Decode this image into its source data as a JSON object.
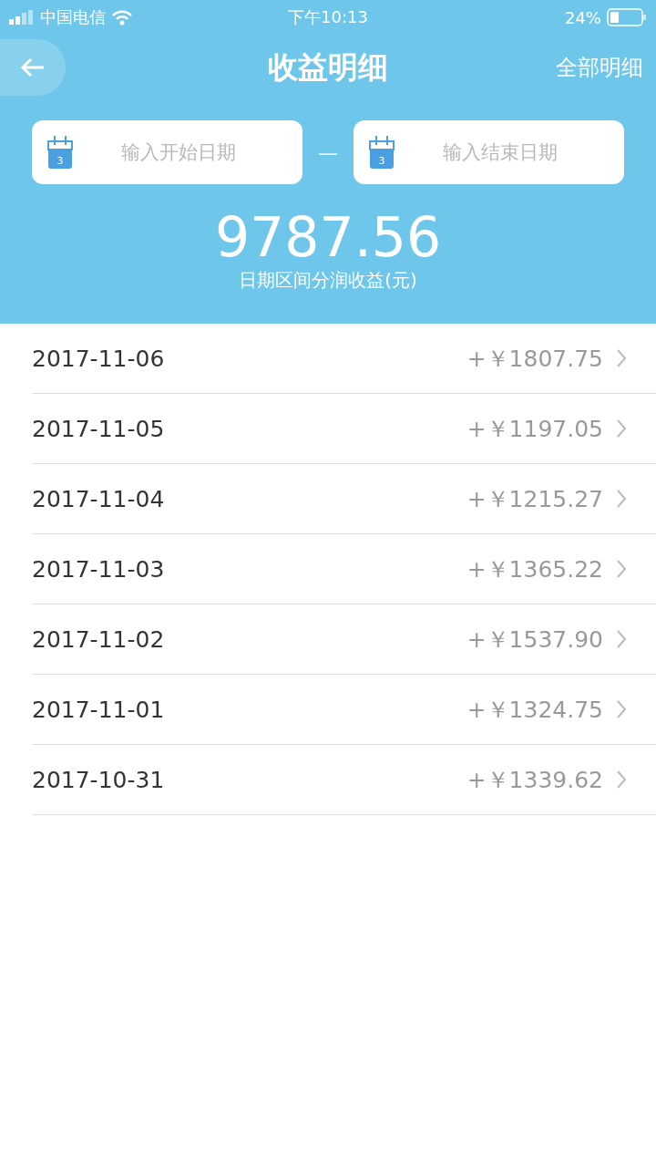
{
  "status_bar": {
    "carrier": "中国电信",
    "time": "下午10:13",
    "battery": "24%"
  },
  "nav": {
    "title": "收益明细",
    "action": "全部明细"
  },
  "date_range": {
    "start": {
      "placeholder": "输入开始日期",
      "icon_day": "3"
    },
    "separator": "—",
    "end": {
      "placeholder": "输入结束日期",
      "icon_day": "3"
    }
  },
  "summary": {
    "amount": "9787.56",
    "caption": "日期区间分润收益(元)"
  },
  "rows": [
    {
      "date": "2017-11-06",
      "amount": "+￥1807.75"
    },
    {
      "date": "2017-11-05",
      "amount": "+￥1197.05"
    },
    {
      "date": "2017-11-04",
      "amount": "+￥1215.27"
    },
    {
      "date": "2017-11-03",
      "amount": "+￥1365.22"
    },
    {
      "date": "2017-11-02",
      "amount": "+￥1537.90"
    },
    {
      "date": "2017-11-01",
      "amount": "+￥1324.75"
    },
    {
      "date": "2017-10-31",
      "amount": "+￥1339.62"
    }
  ]
}
